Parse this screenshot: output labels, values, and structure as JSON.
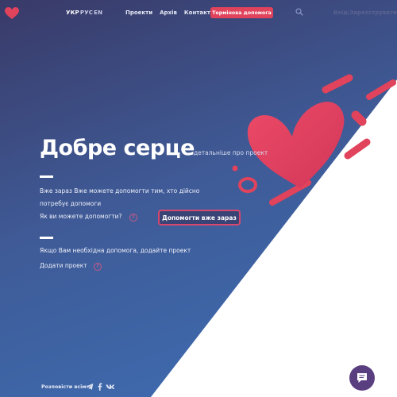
{
  "header": {
    "lang": [
      "УКР",
      "РУС",
      "EN"
    ],
    "nav": [
      "Проекти",
      "Архів",
      "Контакти"
    ],
    "urgent_label": "Термінова допомога",
    "login_label": "Вхід/Зареєструватися"
  },
  "main": {
    "title": "Добре серце",
    "title_link": "детальніше про проект",
    "text1": "Вже зараз Вже можете допомогти тим, хто дійсно потребує допомоги",
    "question": "Як ви можете допомогти?",
    "help_button": "Допомогти вже зараз",
    "text2": "Якщо Вам необхідна допомога, додайте проект",
    "add_link": "Додати проект"
  },
  "footer": {
    "share_label": "Розповісти всім:"
  },
  "colors": {
    "accent": "#e0435b",
    "bg_dark": "#393a68",
    "bg_blue": "#3d6fb5"
  },
  "icons": {
    "logo": "heart-logo-icon",
    "search": "search-icon",
    "social": [
      "telegram-icon",
      "facebook-icon",
      "vk-icon"
    ],
    "chat": "chat-icon"
  }
}
